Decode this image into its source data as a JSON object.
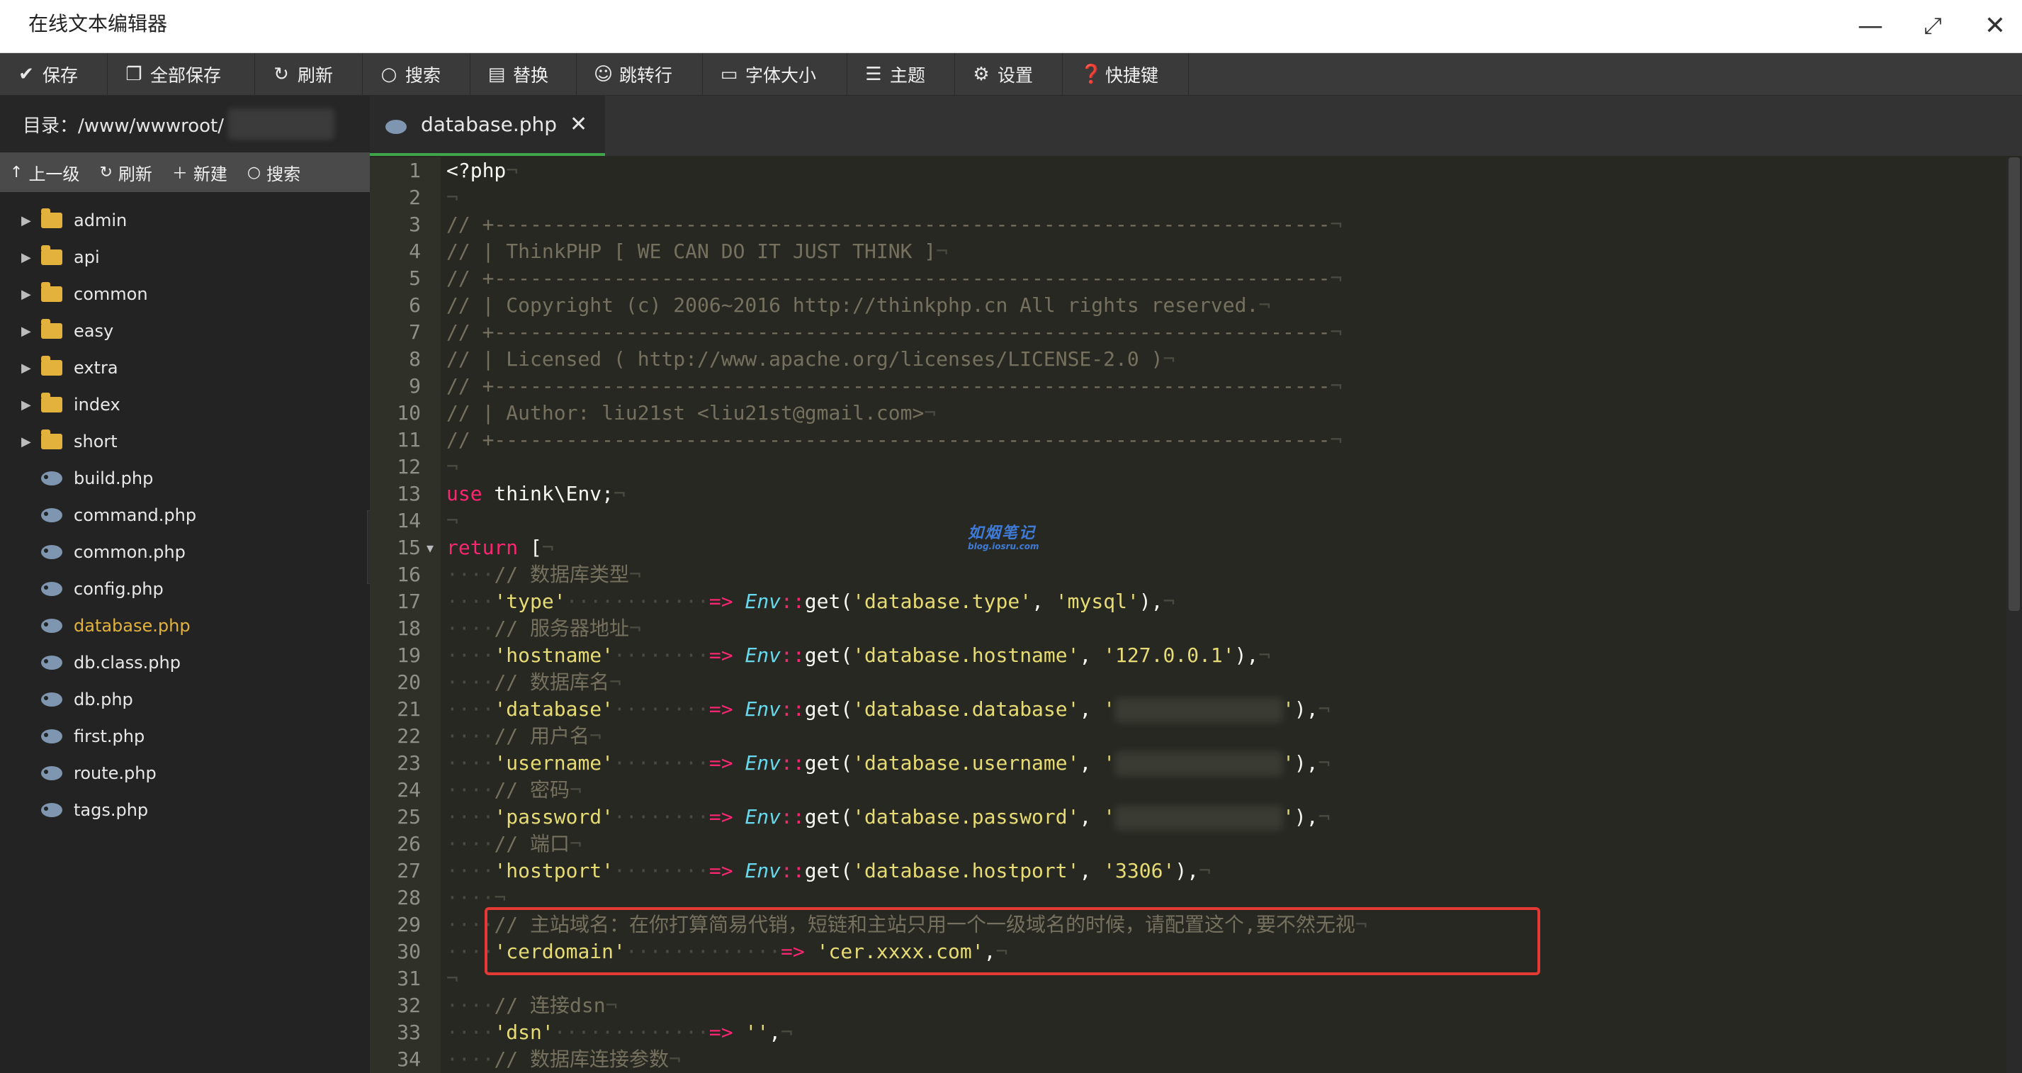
{
  "window": {
    "title": "在线文本编辑器"
  },
  "toolbar": {
    "items": [
      {
        "label": "保存",
        "icon": "check-icon"
      },
      {
        "label": "全部保存",
        "icon": "copy-icon"
      },
      {
        "label": "刷新",
        "icon": "refresh-icon"
      },
      {
        "label": "搜索",
        "icon": "search-icon"
      },
      {
        "label": "替换",
        "icon": "replace-icon"
      },
      {
        "label": "跳转行",
        "icon": "user-icon"
      },
      {
        "label": "字体大小",
        "icon": "font-icon"
      },
      {
        "label": "主题",
        "icon": "menu-icon"
      },
      {
        "label": "设置",
        "icon": "gear-icon"
      },
      {
        "label": "快捷键",
        "icon": "help-icon"
      }
    ]
  },
  "sidebar": {
    "dir_label": "目录：/www/wwwroot/",
    "tools": [
      {
        "label": "上一级",
        "icon": "up-arrow-icon"
      },
      {
        "label": "刷新",
        "icon": "refresh-icon"
      },
      {
        "label": "新建",
        "icon": "plus-icon"
      },
      {
        "label": "搜索",
        "icon": "search-icon"
      }
    ],
    "folders": [
      "admin",
      "api",
      "common",
      "easy",
      "extra",
      "index",
      "short"
    ],
    "files": [
      "build.php",
      "command.php",
      "common.php",
      "config.php",
      "database.php",
      "db.class.php",
      "db.php",
      "first.php",
      "route.php",
      "tags.php"
    ],
    "active_file": "database.php"
  },
  "editor": {
    "tab_label": "database.php",
    "watermark": {
      "title": "如烟笔记",
      "url": "blog.iosru.com"
    },
    "line_numbers": [
      "1",
      "2",
      "3",
      "4",
      "5",
      "6",
      "7",
      "8",
      "9",
      "10",
      "11",
      "12",
      "13",
      "14",
      "15",
      "16",
      "17",
      "18",
      "19",
      "20",
      "21",
      "22",
      "23",
      "24",
      "25",
      "26",
      "27",
      "28",
      "29",
      "30",
      "31",
      "32",
      "33",
      "34"
    ]
  },
  "colors": {
    "accent_green": "#3fa54a",
    "folder": "#e2b23d",
    "highlight_border": "#e53935"
  }
}
